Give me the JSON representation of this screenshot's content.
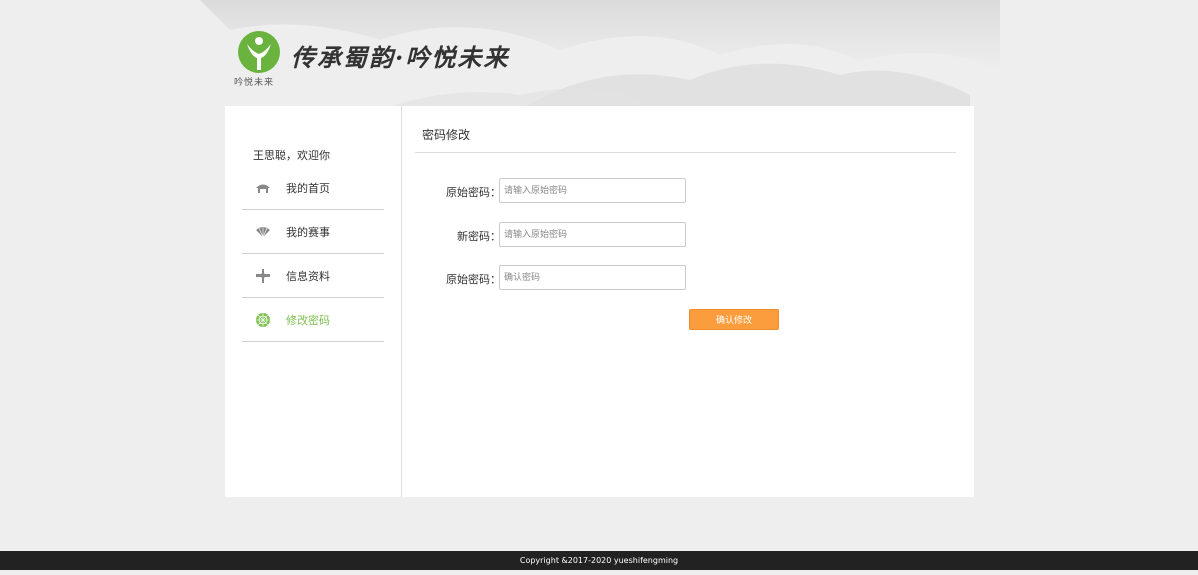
{
  "header": {
    "logo_text": "吟悦未来",
    "slogan": "传承蜀韵·吟悦未来"
  },
  "sidebar": {
    "welcome": "王思聪，欢迎你",
    "items": [
      {
        "label": "我的首页",
        "icon": "pavilion-icon",
        "active": false
      },
      {
        "label": "我的赛事",
        "icon": "fan-icon",
        "active": false
      },
      {
        "label": "信息资料",
        "icon": "cross-ornament-icon",
        "active": false
      },
      {
        "label": "修改密码",
        "icon": "flower-icon",
        "active": true
      }
    ]
  },
  "main": {
    "title": "密码修改",
    "fields": [
      {
        "label": "原始密码：",
        "placeholder": "请输入原始密码",
        "value": ""
      },
      {
        "label": "新密码：",
        "placeholder": "请输入原始密码",
        "value": ""
      },
      {
        "label": "原始密码：",
        "placeholder": "确认密码",
        "value": ""
      }
    ],
    "submit_label": "确认修改"
  },
  "footer": {
    "copyright": "Copyright &2017-2020 yueshifengming"
  },
  "colors": {
    "accent_green": "#7cc04e",
    "button_orange": "#fc9d3d",
    "footer_bg": "#222222"
  }
}
